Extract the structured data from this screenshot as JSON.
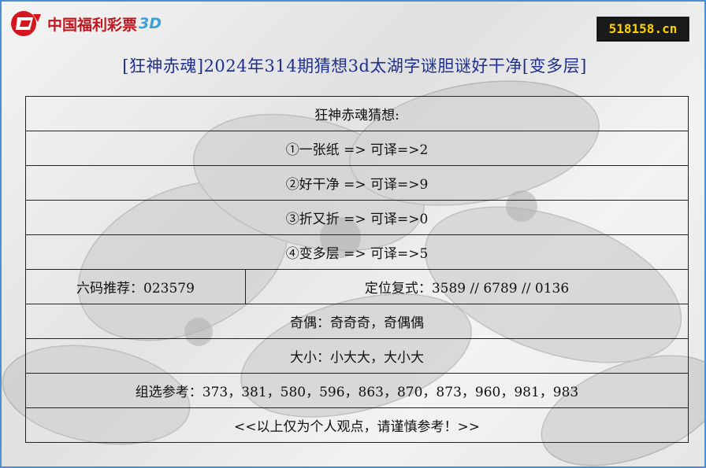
{
  "logo": {
    "text": "中国福利彩票",
    "suffix": "3D",
    "icon": "lottery-logo-icon"
  },
  "site_badge": "518158.cn",
  "title": "[狂神赤魂]2024年314期猜想3d太湖字谜胆谜好干净[变多层]",
  "table": {
    "header": "狂神赤魂猜想:",
    "clues": [
      "①一张纸 => 可译=>2",
      "②好干净 => 可译=>9",
      "③折又折 => 可译=>0",
      "④变多层 => 可译=>5"
    ],
    "six_code": "六码推荐：023579",
    "position_combo": "定位复式：3589 // 6789 // 0136",
    "odd_even": "奇偶：奇奇奇，奇偶偶",
    "big_small": "大小：小大大，大小大",
    "group_ref": "组选参考：373，381，580，596，863，870，873，960，981，983",
    "disclaimer": "<<以上仅为个人观点，请谨慎参考！>>"
  },
  "colors": {
    "border": "#4a90d0",
    "title": "#1f2f8f",
    "logo_red": "#c0161e",
    "badge_bg": "#1a1a1a",
    "badge_text": "#ffd200"
  }
}
